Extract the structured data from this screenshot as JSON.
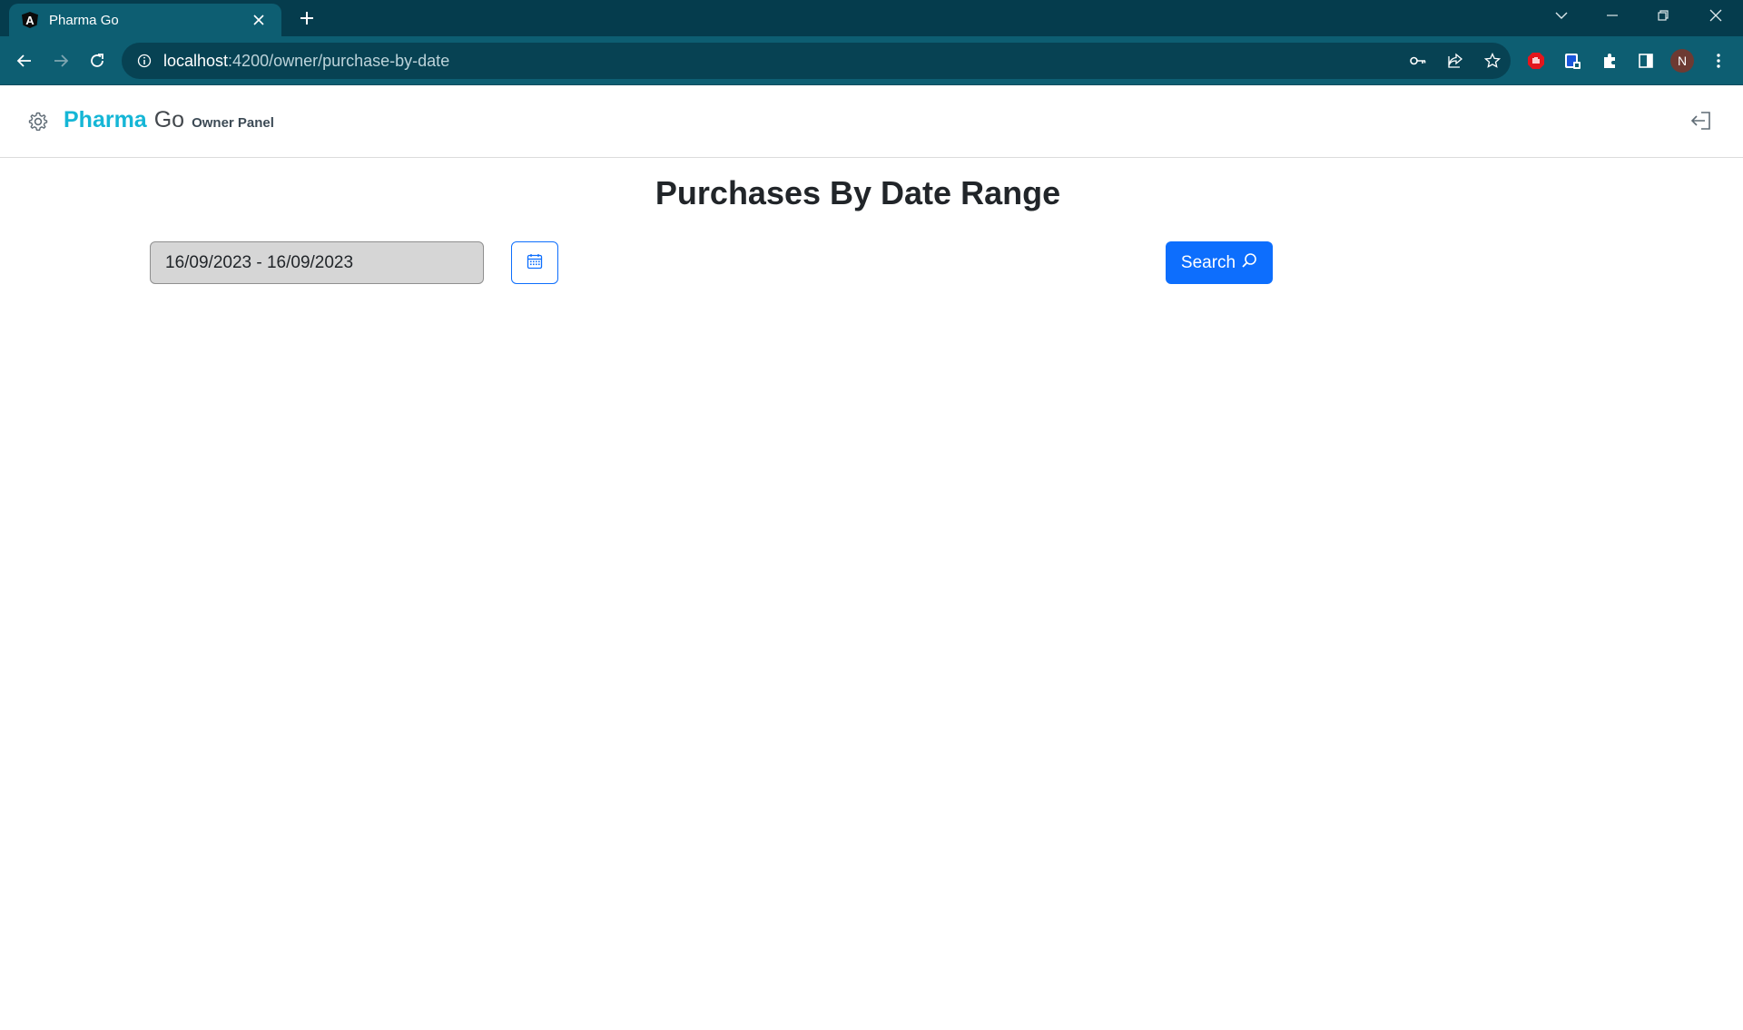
{
  "browser": {
    "tab": {
      "title": "Pharma Go",
      "favicon_letter": "A",
      "favicon_icon": "angular-icon"
    },
    "url": {
      "host": "localhost",
      "rest": ":4200/owner/purchase-by-date"
    },
    "profile_initial": "N",
    "colors": {
      "tabstrip": "#053c4d",
      "toolbar": "#0d5e72",
      "omnibox": "#074253"
    }
  },
  "app": {
    "brand": {
      "name": "Pharma",
      "suffix": "Go",
      "panel": "Owner Panel"
    },
    "colors": {
      "brand": "#15b6d6",
      "primary": "#0d6efd"
    }
  },
  "page": {
    "title": "Purchases By Date Range",
    "date_range": {
      "value": "16/09/2023 - 16/09/2023"
    },
    "search_label": "Search"
  }
}
